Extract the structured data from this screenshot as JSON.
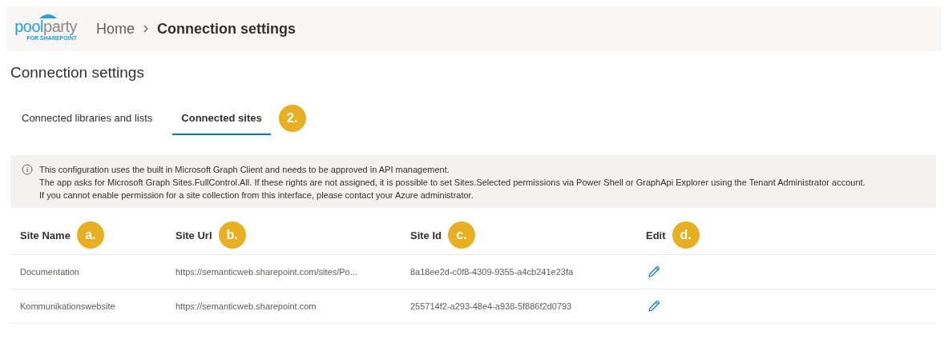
{
  "header": {
    "logo": {
      "word_a": "pool",
      "word_b": "party",
      "tagline": "FOR SHAREPOINT"
    },
    "breadcrumb": [
      "Home",
      "Connection settings"
    ]
  },
  "page_title": "Connection settings",
  "tabs": [
    {
      "label": "Connected libraries and lists",
      "selected": false
    },
    {
      "label": "Connected sites",
      "selected": true,
      "badge": "2."
    }
  ],
  "info": {
    "lines": [
      "This configuration uses the built in Microsoft Graph Client and needs to be approved in API management.",
      "The app asks for Microsoft Graph Sites.FullControl.All. If these rights are not assigned, it is possible to set Sites.Selected permissions via Power Shell or GraphApi Explorer using the Tenant Administrator account.",
      "If you cannot enable permission for a site collection from this interface, please contact your Azure administrator."
    ]
  },
  "table": {
    "columns": [
      {
        "label": "Site Name",
        "badge": "a."
      },
      {
        "label": "Site Url",
        "badge": "b."
      },
      {
        "label": "Site Id",
        "badge": "c."
      },
      {
        "label": "Edit",
        "badge": "d."
      }
    ],
    "rows": [
      {
        "name": "Documentation",
        "url": "https://semanticweb.sharepoint.com/sites/Po...",
        "id": "8a18ee2d-c0f8-4309-9355-a4cb241e23fa"
      },
      {
        "name": "Kommunikationswebsite",
        "url": "https://semanticweb.sharepoint.com",
        "id": "255714f2-a293-48e4-a938-5f886f2d0793"
      }
    ]
  }
}
